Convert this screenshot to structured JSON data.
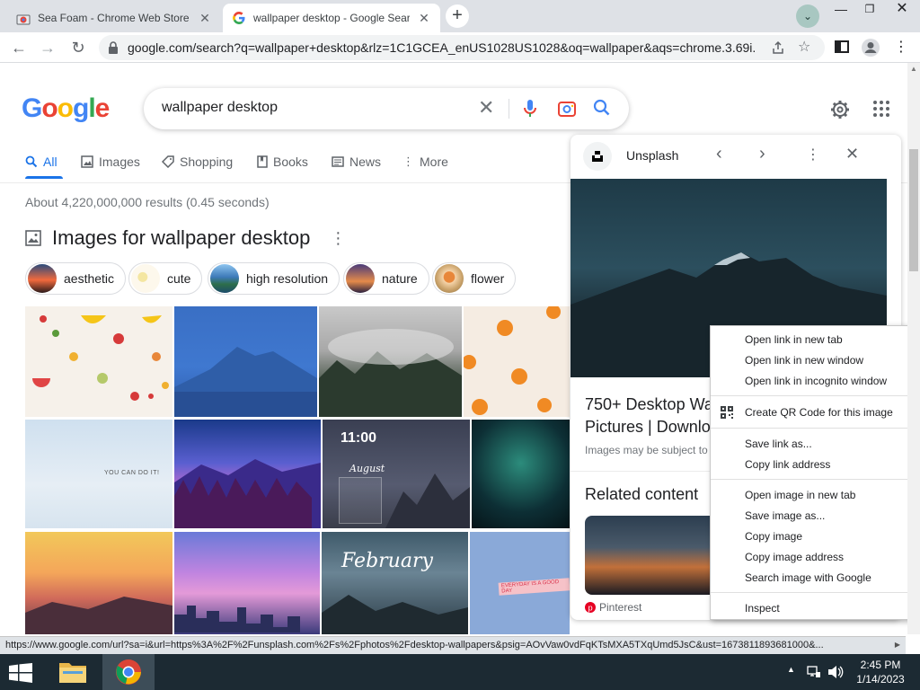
{
  "tabs": [
    {
      "title": "Sea Foam - Chrome Web Store",
      "active": false
    },
    {
      "title": "wallpaper desktop - Google Sear",
      "active": true
    }
  ],
  "address_bar": {
    "url": "google.com/search?q=wallpaper+desktop&rlz=1C1GCEA_enUS1028US1028&oq=wallpaper&aqs=chrome.3.69i..."
  },
  "search": {
    "query": "wallpaper desktop"
  },
  "google_logo": {
    "letters": [
      "G",
      "o",
      "o",
      "g",
      "l",
      "e"
    ],
    "colors": [
      "#4285f4",
      "#ea4335",
      "#fbbc05",
      "#4285f4",
      "#34a853",
      "#ea4335"
    ]
  },
  "nav_tabs": [
    {
      "label": "All",
      "icon": "search-icon",
      "selected": true
    },
    {
      "label": "Images",
      "icon": "image-icon"
    },
    {
      "label": "Shopping",
      "icon": "tag-icon"
    },
    {
      "label": "Books",
      "icon": "book-icon"
    },
    {
      "label": "News",
      "icon": "newspaper-icon"
    },
    {
      "label": "More",
      "icon": "more-vert-icon"
    }
  ],
  "results_stats": "About 4,220,000,000 results (0.45 seconds)",
  "images_section": {
    "title": "Images for wallpaper desktop"
  },
  "chips": [
    {
      "label": "aesthetic"
    },
    {
      "label": "cute"
    },
    {
      "label": "high resolution"
    },
    {
      "label": "nature"
    },
    {
      "label": "flower"
    }
  ],
  "thumb_texts": {
    "calendar_time": "11:00",
    "calendar_month": "August",
    "february": "February",
    "you_can_do_it": "YOU CAN DO IT!",
    "everyday_good": "EVERYDAY IS A GOOD DAY"
  },
  "side_panel": {
    "source": "Unsplash",
    "title_line1": "750+ Desktop Wa",
    "title_line2": "Pictures | Downlo",
    "subtitle": "Images may be subject to",
    "related_heading": "Related content",
    "related_source": "Pinterest"
  },
  "context_menu": {
    "group1": [
      "Open link in new tab",
      "Open link in new window",
      "Open link in incognito window"
    ],
    "group2": [
      "Create QR Code for this image"
    ],
    "group3": [
      "Save link as...",
      "Copy link address"
    ],
    "group4": [
      "Open image in new tab",
      "Save image as...",
      "Copy image",
      "Copy image address",
      "Search image with Google"
    ],
    "group5": [
      "Inspect"
    ]
  },
  "status_bar": {
    "url": "https://www.google.com/url?sa=i&url=https%3A%2F%2Funsplash.com%2Fs%2Fphotos%2Fdesktop-wallpapers&psig=AOvVaw0vdFqKTsMXA5TXqUmd5JsC&ust=1673811893681000&..."
  },
  "taskbar": {
    "time": "2:45 PM",
    "date": "1/14/2023"
  },
  "colors": {
    "accent": "#1a73e8",
    "tabbar": "#dee1e6",
    "taskbar": "#1c2a33"
  }
}
